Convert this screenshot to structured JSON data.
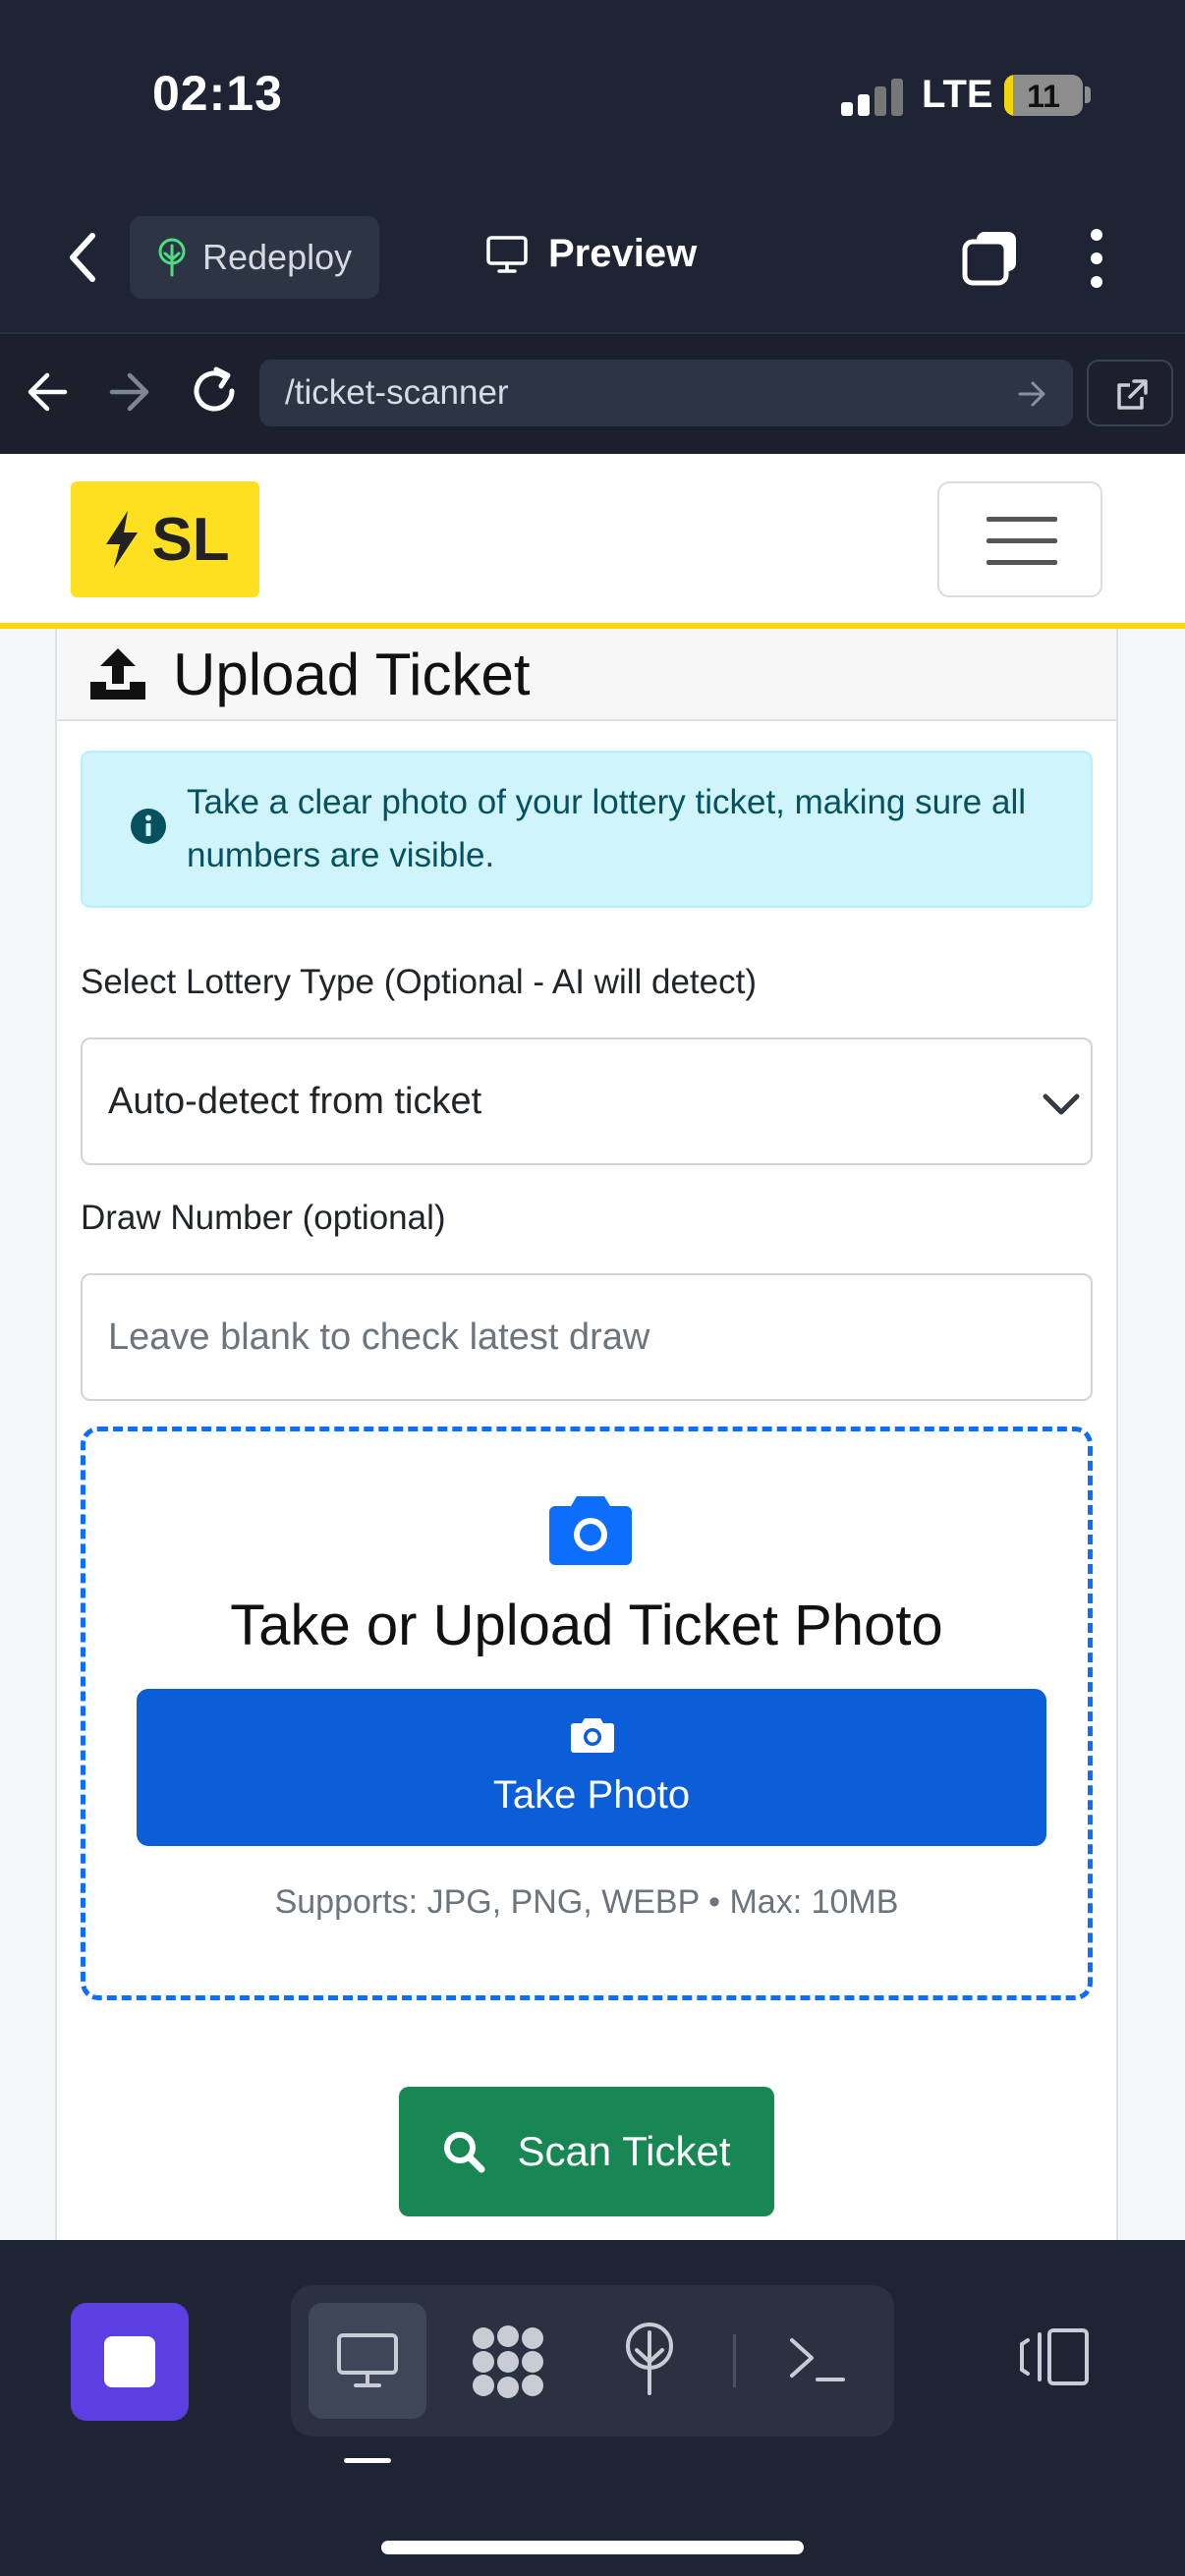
{
  "status": {
    "time": "02:13",
    "network": "LTE",
    "battery": "11",
    "battery_level": 0.11
  },
  "appbar": {
    "redeploy_label": "Redeploy",
    "preview_label": "Preview"
  },
  "browser": {
    "url": "/ticket-scanner"
  },
  "site": {
    "logo_text": "SL"
  },
  "card": {
    "title": "Upload Ticket"
  },
  "alert": {
    "text": "Take a clear photo of your lottery ticket, making sure all numbers are visible."
  },
  "form": {
    "lottery_label": "Select Lottery Type (Optional - AI will detect)",
    "lottery_selected": "Auto-detect from ticket",
    "draw_label": "Draw Number (optional)",
    "draw_placeholder": "Leave blank to check latest draw"
  },
  "dropzone": {
    "title": "Take or Upload Ticket Photo",
    "button_label": "Take Photo",
    "note": "Supports: JPG, PNG, WEBP • Max: 10MB"
  },
  "scan": {
    "label": "Scan Ticket"
  },
  "colors": {
    "accent_yellow": "#ffd60a",
    "primary": "#0b5ed7",
    "success": "#198754",
    "stop_purple": "#5b3fe0"
  }
}
